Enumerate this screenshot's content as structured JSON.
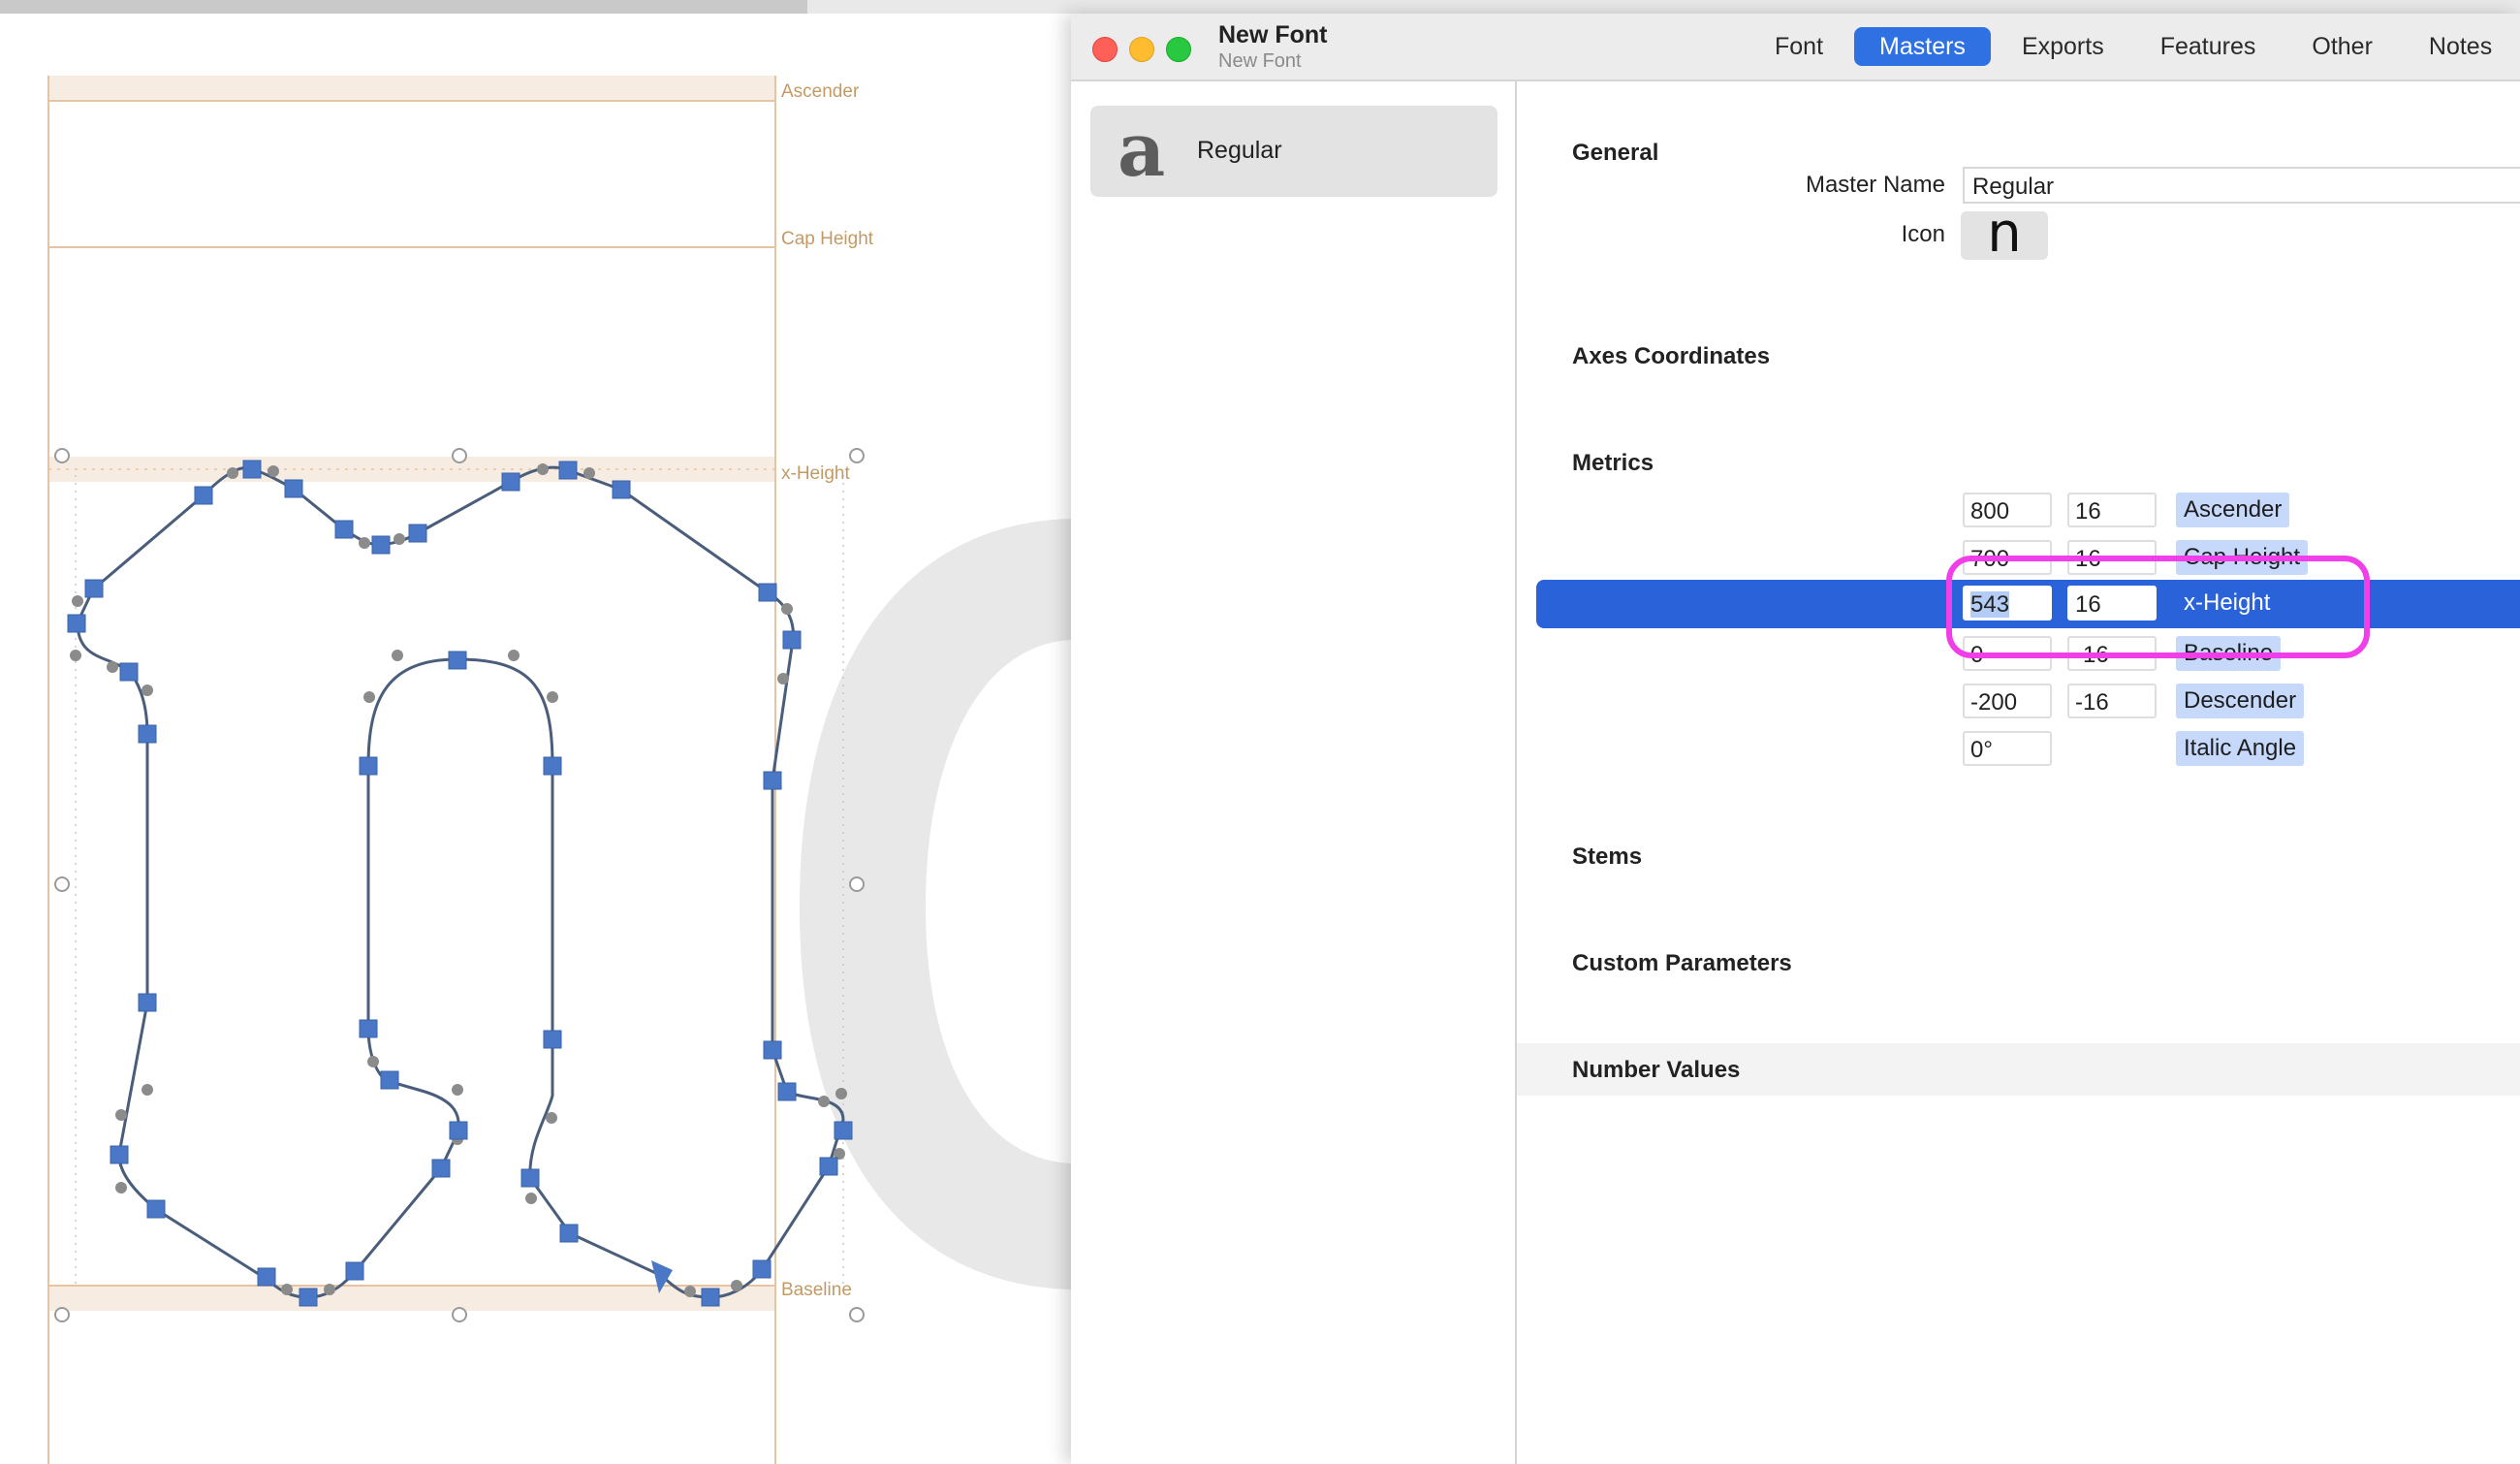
{
  "canvas": {
    "metric_labels": {
      "ascender": "Ascender",
      "cap_height": "Cap Height",
      "x_height": "x-Height",
      "baseline": "Baseline"
    },
    "colors": {
      "metric_line": "#e6c3a2",
      "node": "#4a78c6",
      "handle": "#8b8b8b",
      "outline": "#4a5d7a"
    }
  },
  "window": {
    "title": "New Font",
    "subtitle": "New Font",
    "tabs": [
      {
        "label": "Font",
        "active": false
      },
      {
        "label": "Masters",
        "active": true
      },
      {
        "label": "Exports",
        "active": false
      },
      {
        "label": "Features",
        "active": false
      },
      {
        "label": "Other",
        "active": false
      },
      {
        "label": "Notes",
        "active": false
      }
    ]
  },
  "sidebar": {
    "master": {
      "icon_glyph": "a",
      "name": "Regular"
    }
  },
  "general": {
    "title": "General",
    "master_name_label": "Master Name",
    "master_name_value": "Regular",
    "icon_label": "Icon",
    "icon_glyph": "n"
  },
  "axes": {
    "title": "Axes Coordinates"
  },
  "metrics": {
    "title": "Metrics",
    "rows": [
      {
        "value": "800",
        "overshoot": "16",
        "name": "Ascender"
      },
      {
        "value": "700",
        "overshoot": "16",
        "name": "Cap Height"
      },
      {
        "value": "543",
        "overshoot": "16",
        "name": "x-Height"
      },
      {
        "value": "0",
        "overshoot": "-16",
        "name": "Baseline"
      },
      {
        "value": "-200",
        "overshoot": "-16",
        "name": "Descender"
      },
      {
        "value": "0°",
        "overshoot": "",
        "name": "Italic Angle"
      }
    ],
    "selected_index": 2,
    "highlight_color": "#f03fe9"
  },
  "stems": {
    "title": "Stems"
  },
  "custom_parameters": {
    "title": "Custom Parameters"
  },
  "number_values": {
    "title": "Number Values"
  }
}
